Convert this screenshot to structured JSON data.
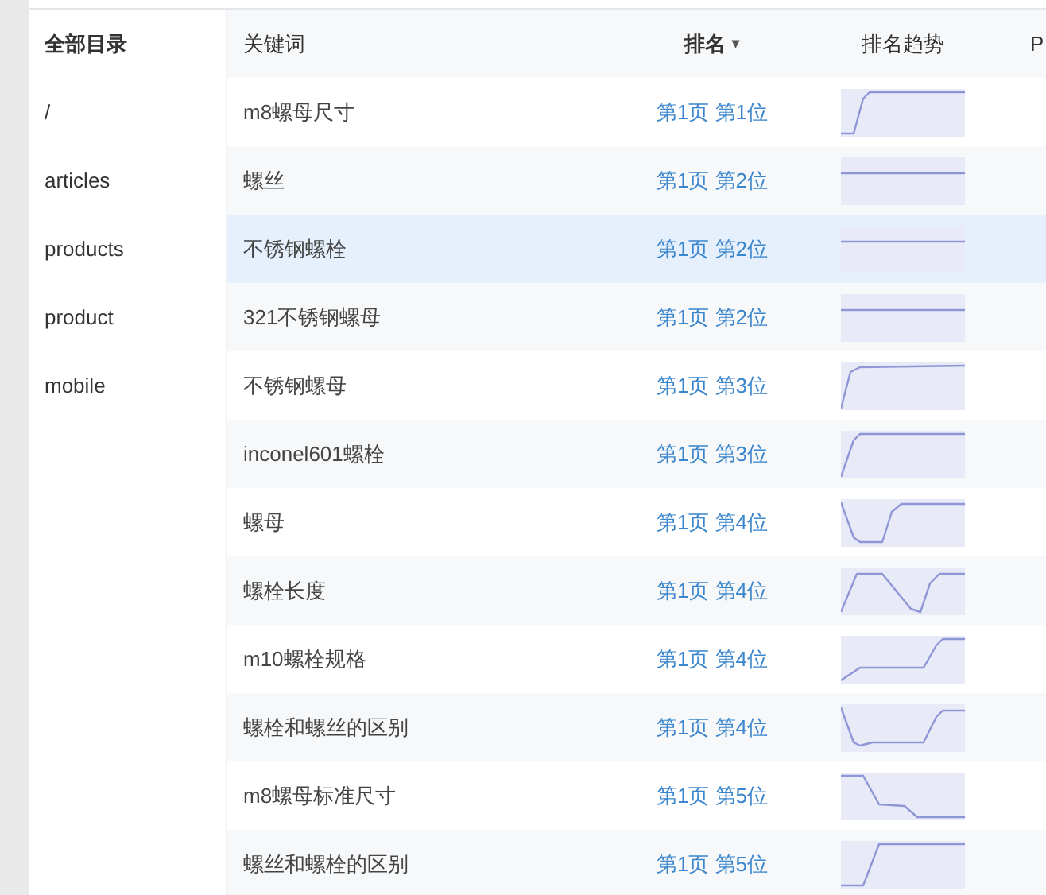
{
  "sidebar": {
    "title": "全部目录",
    "items": [
      {
        "label": "/"
      },
      {
        "label": "articles"
      },
      {
        "label": "products"
      },
      {
        "label": "product"
      },
      {
        "label": "mobile"
      }
    ]
  },
  "table": {
    "columns": [
      {
        "label": "关键词"
      },
      {
        "label": "排名",
        "sort": "▾"
      },
      {
        "label": "排名趋势"
      },
      {
        "label": "P"
      }
    ],
    "rows": [
      {
        "keyword": "m8螺母尺寸",
        "rank": "第1页 第1位",
        "highlighted": false
      },
      {
        "keyword": "螺丝",
        "rank": "第1页 第2位",
        "highlighted": false
      },
      {
        "keyword": "不锈钢螺栓",
        "rank": "第1页 第2位",
        "highlighted": true
      },
      {
        "keyword": "321不锈钢螺母",
        "rank": "第1页 第2位",
        "highlighted": false
      },
      {
        "keyword": "不锈钢螺母",
        "rank": "第1页 第3位",
        "highlighted": false
      },
      {
        "keyword": "inconel601螺栓",
        "rank": "第1页 第3位",
        "highlighted": false
      },
      {
        "keyword": "螺母",
        "rank": "第1页 第4位",
        "highlighted": false
      },
      {
        "keyword": "螺栓长度",
        "rank": "第1页 第4位",
        "highlighted": false
      },
      {
        "keyword": "m10螺栓规格",
        "rank": "第1页 第4位",
        "highlighted": false
      },
      {
        "keyword": "螺栓和螺丝的区别",
        "rank": "第1页 第4位",
        "highlighted": false
      },
      {
        "keyword": "m8螺母标准尺寸",
        "rank": "第1页 第5位",
        "highlighted": false
      },
      {
        "keyword": "螺丝和螺栓的区别",
        "rank": "第1页 第5位",
        "highlighted": false
      }
    ]
  }
}
